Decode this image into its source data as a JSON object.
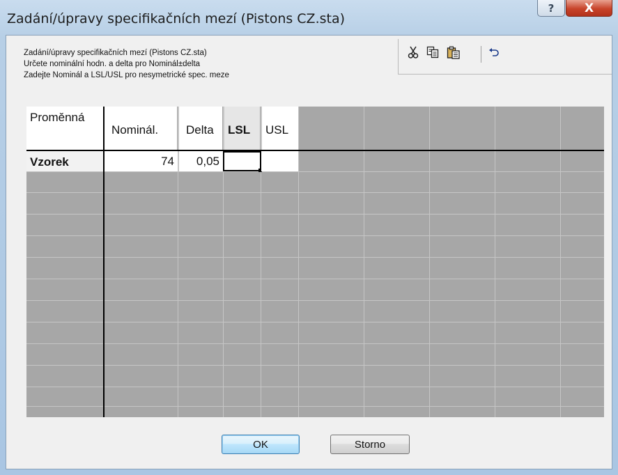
{
  "window": {
    "title": "Zadání/úpravy specifikačních mezí (Pistons CZ.sta)",
    "help_glyph": "?",
    "close_glyph": "X"
  },
  "description": {
    "line1": "Zadání/úpravy specifikačních mezí (Pistons CZ.sta)",
    "line2": "Určete nominální hodn. a delta pro Nominál±delta",
    "line3": "Zadejte Nominál a LSL/USL pro nesymetrické spec. meze"
  },
  "toolbar": {
    "cut_icon": "scissors-icon",
    "copy_icon": "copy-icon",
    "paste_icon": "paste-icon",
    "undo_icon": "undo-icon"
  },
  "grid": {
    "corner_label": "Proměnná",
    "columns": [
      "Nominál.",
      "Delta",
      "LSL",
      "USL"
    ],
    "row": {
      "label": "Vzorek",
      "nominal": "74",
      "delta": "0,05",
      "lsl": "",
      "usl": ""
    },
    "active_column": "LSL"
  },
  "buttons": {
    "ok": "OK",
    "cancel": "Storno"
  },
  "colors": {
    "grid_background": "#a7a7a7",
    "ok_highlight": "#3c7fb1",
    "close_button": "#c7432a"
  }
}
